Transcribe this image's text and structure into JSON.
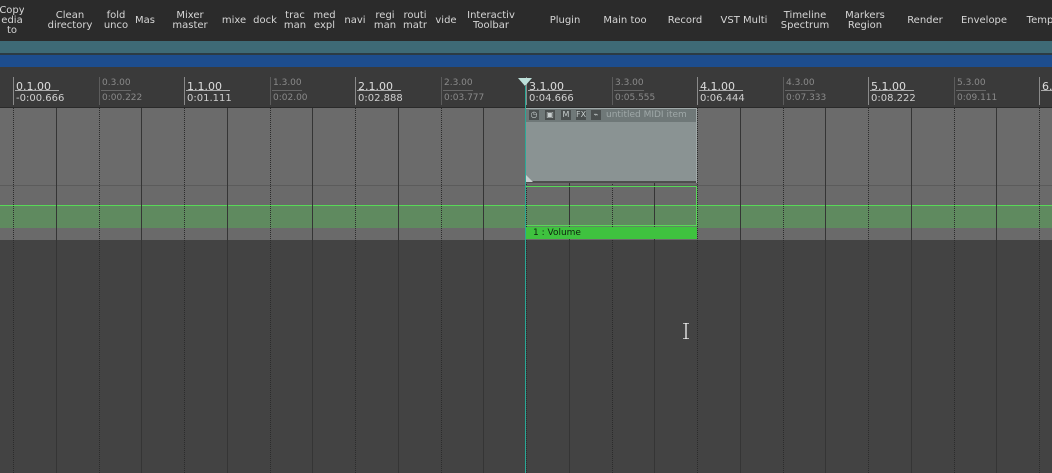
{
  "toolbar": [
    {
      "label": "Copy\nedia to"
    },
    {
      "label": "Clean\ndirectory"
    },
    {
      "label": "fold\nunco"
    },
    {
      "label": "Mas"
    },
    {
      "label": "Mixer\nmaster"
    },
    {
      "label": "mixe"
    },
    {
      "label": "dock"
    },
    {
      "label": "trac\nman"
    },
    {
      "label": "med\nexpl"
    },
    {
      "label": "navi"
    },
    {
      "label": "regi\nman"
    },
    {
      "label": "routi\nmatr"
    },
    {
      "label": "vide"
    },
    {
      "label": "Interactiv\nToolbar"
    },
    {
      "label": "Plugin"
    },
    {
      "label": "Main too"
    },
    {
      "label": "Record"
    },
    {
      "label": "VST Multi"
    },
    {
      "label": "Timeline\nSpectrum"
    },
    {
      "label": "Markers\nRegion"
    },
    {
      "label": "Render"
    },
    {
      "label": "Envelope"
    },
    {
      "label": "Temp"
    }
  ],
  "ruler": [
    {
      "bar": "0.1.00",
      "time": "-0:00.666",
      "major": true
    },
    {
      "bar": "0.3.00",
      "time": "0:00.222",
      "major": false
    },
    {
      "bar": "1.1.00",
      "time": "0:01.111",
      "major": true
    },
    {
      "bar": "1.3.00",
      "time": "0:02.00",
      "major": false
    },
    {
      "bar": "2.1.00",
      "time": "0:02.888",
      "major": true
    },
    {
      "bar": "2.3.00",
      "time": "0:03.777",
      "major": false
    },
    {
      "bar": "3.1.00",
      "time": "0:04.666",
      "major": true
    },
    {
      "bar": "3.3.00",
      "time": "0:05.555",
      "major": false
    },
    {
      "bar": "4.1.00",
      "time": "0:06.444",
      "major": true
    },
    {
      "bar": "4.3.00",
      "time": "0:07.333",
      "major": false
    },
    {
      "bar": "5.1.00",
      "time": "0:08.222",
      "major": true
    },
    {
      "bar": "5.3.00",
      "time": "0:09.111",
      "major": false
    },
    {
      "bar": "6.",
      "time": "",
      "major": true
    }
  ],
  "midi_item": {
    "name": "untitled MIDI item",
    "icons": [
      "clock-icon",
      "lock-icon",
      "M",
      "FX",
      "wave-icon"
    ]
  },
  "envelope": {
    "label": "1 : Volume",
    "color": "#3fc23f"
  },
  "colors": {
    "playhead": "#2aa896",
    "band1": "#3e6a76",
    "band2": "#1d4d8e"
  }
}
